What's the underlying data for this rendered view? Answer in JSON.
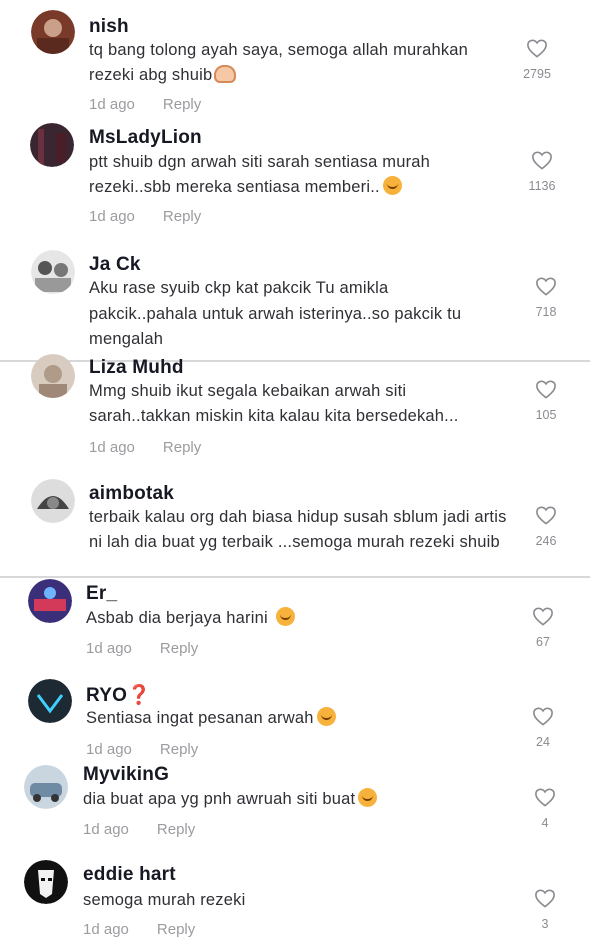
{
  "ui": {
    "reply_label": "Reply"
  },
  "comments": [
    {
      "username": "nish",
      "text": "tq bang tolong ayah saya, semoga allah murahkan rezeki abg shuib",
      "emoji": "hands",
      "time": "1d ago",
      "likes": "2795",
      "avatar_color": "#7a3a2a"
    },
    {
      "username": "MsLadyLion",
      "text": "ptt shuib dgn arwah siti sarah sentiasa murah rezeki..sbb mereka sentiasa memberi..",
      "emoji": "smile",
      "time": "1d ago",
      "likes": "1136",
      "avatar_color": "#3a2630"
    },
    {
      "username": "Ja Ck",
      "text": "Aku rase syuib ckp kat pakcik Tu amikla pakcik..pahala untuk arwah isterinya..so pakcik tu mengalah",
      "emoji": "",
      "time": "",
      "likes": "718",
      "avatar_color": "#d9d9d9"
    },
    {
      "username": "Liza Muhd",
      "text": "Mmg shuib ikut segala kebaikan arwah siti sarah..takkan miskin kita kalau kita bersedekah...",
      "emoji": "",
      "time": "1d ago",
      "likes": "105",
      "avatar_color": "#c8b8a8"
    },
    {
      "username": "aimbotak",
      "text": "terbaik kalau org dah biasa hidup susah sblum jadi artis ni lah dia buat yg terbaik ...semoga murah rezeki shuib",
      "emoji": "",
      "time": "",
      "likes": "246",
      "avatar_color": "#5a5a5a"
    },
    {
      "username": "Er_",
      "text": "Asbab dia berjaya harini",
      "emoji": "smile",
      "time": "1d ago",
      "likes": "67",
      "avatar_color": "#3b2f7a"
    },
    {
      "username": "RYO",
      "username_emoji": "❓",
      "text": "Sentiasa ingat pesanan arwah",
      "emoji": "smile",
      "time": "1d ago",
      "likes": "24",
      "avatar_color": "#1d2a33"
    },
    {
      "username": "MyvikinG",
      "text": "dia buat apa yg pnh awruah siti buat",
      "emoji": "smile",
      "time": "1d ago",
      "likes": "4",
      "avatar_color": "#6f8aa3"
    },
    {
      "username": "eddie hart",
      "text": "semoga murah rezeki",
      "emoji": "",
      "time": "1d ago",
      "likes": "3",
      "avatar_color": "#111111"
    }
  ]
}
